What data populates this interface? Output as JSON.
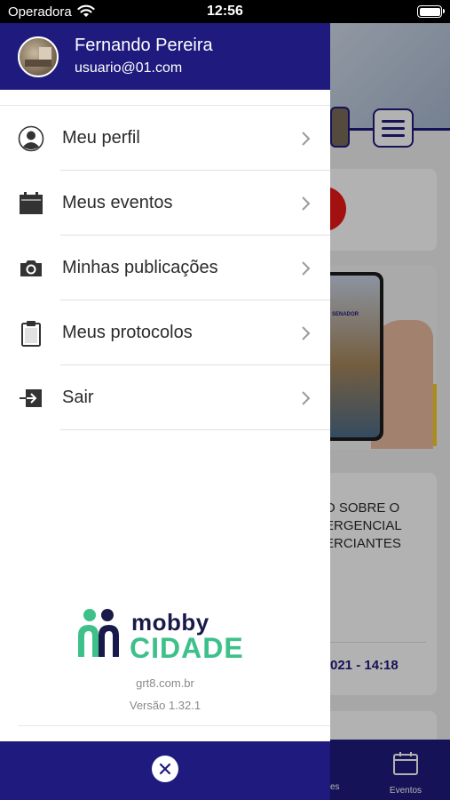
{
  "status_bar": {
    "carrier": "Operadora",
    "time": "12:56",
    "icons": [
      "wifi-icon",
      "battery-icon"
    ]
  },
  "user": {
    "name": "Fernando Pereira",
    "email": "usuario@01.com"
  },
  "menu": {
    "items": [
      {
        "label": "Meu perfil",
        "icon": "person-icon"
      },
      {
        "label": "Meus eventos",
        "icon": "calendar-icon"
      },
      {
        "label": "Minhas publicações",
        "icon": "camera-icon"
      },
      {
        "label": "Meus protocolos",
        "icon": "clipboard-icon"
      },
      {
        "label": "Sair",
        "icon": "logout-icon"
      }
    ]
  },
  "brand": {
    "word1": "mobby",
    "word2": "CIDADE",
    "site": "grt8.com.br",
    "version": "Versão 1.32.1"
  },
  "background": {
    "news_lines": [
      "O SOBRE O",
      "ERGENCIAL",
      "ERCIANTES"
    ],
    "news_date": "021 - 14:18",
    "tab_events": "Eventos",
    "tab_partial": "es"
  },
  "colors": {
    "primary": "#1f1a7d",
    "brand_green": "#3ec08a",
    "brand_dark": "#1a1a4a"
  }
}
